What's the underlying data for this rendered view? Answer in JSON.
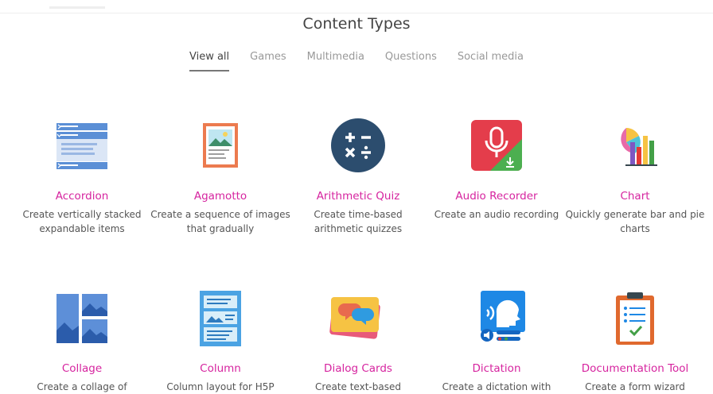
{
  "page": {
    "title": "Content Types"
  },
  "tabs": [
    "View all",
    "Games",
    "Multimedia",
    "Questions",
    "Social media"
  ],
  "items": [
    {
      "name": "Accordion",
      "desc": "Create vertically stacked expandable items",
      "icon": "accordion-icon"
    },
    {
      "name": "Agamotto",
      "desc": "Create a sequence of images that gradually",
      "icon": "agamotto-icon"
    },
    {
      "name": "Arithmetic Quiz",
      "desc": "Create time-based arithmetic quizzes",
      "icon": "arithmetic-quiz-icon"
    },
    {
      "name": "Audio Recorder",
      "desc": "Create an audio recording",
      "icon": "audio-recorder-icon"
    },
    {
      "name": "Chart",
      "desc": "Quickly generate bar and pie charts",
      "icon": "chart-icon"
    },
    {
      "name": "Collage",
      "desc": "Create a collage of",
      "icon": "collage-icon"
    },
    {
      "name": "Column",
      "desc": "Column layout for H5P",
      "icon": "column-icon"
    },
    {
      "name": "Dialog Cards",
      "desc": "Create text-based",
      "icon": "dialog-cards-icon"
    },
    {
      "name": "Dictation",
      "desc": "Create a dictation with",
      "icon": "dictation-icon"
    },
    {
      "name": "Documentation Tool",
      "desc": "Create a form wizard",
      "icon": "documentation-tool-icon"
    }
  ]
}
